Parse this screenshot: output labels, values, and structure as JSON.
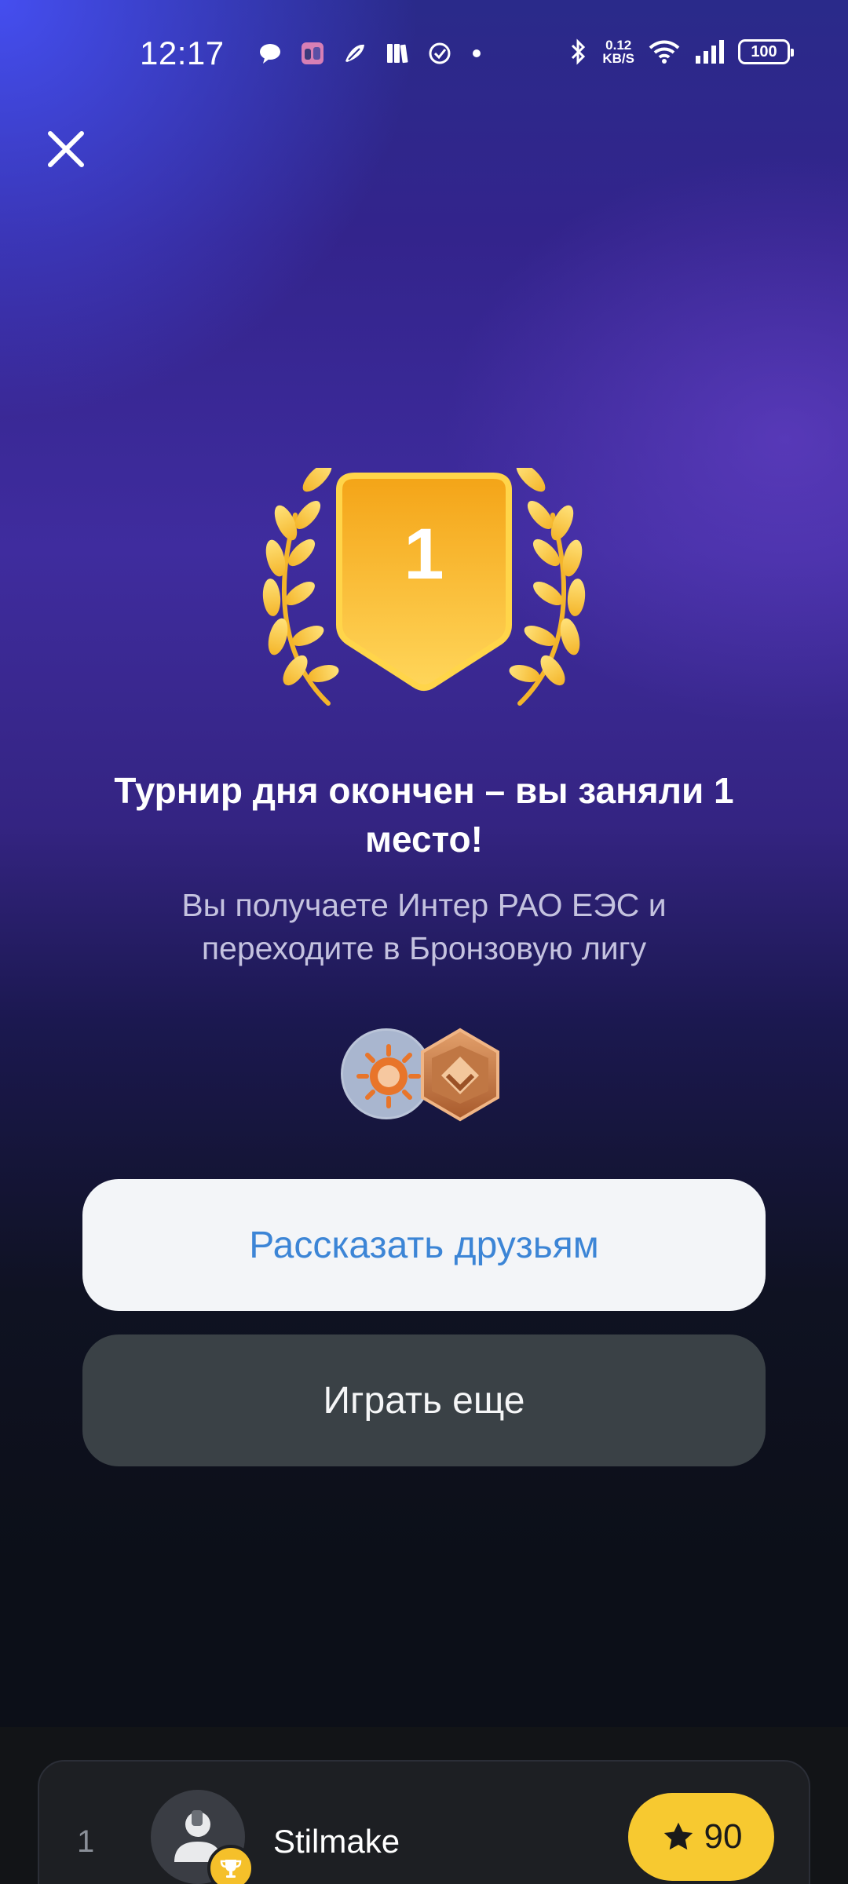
{
  "status_bar": {
    "time": "12:17",
    "net_speed_value": "0.12",
    "net_speed_unit": "KB/S",
    "battery": "100",
    "left_icons": [
      "chat-bubble-icon",
      "app-thumbnail-icon",
      "feather-icon",
      "library-icon",
      "check-circle-icon",
      "dot-icon"
    ],
    "right_icons": [
      "bluetooth-icon",
      "wifi-icon",
      "signal-icon",
      "battery-icon"
    ]
  },
  "result": {
    "place": "1",
    "title": "Турнир дня окончен – вы заняли 1 место!",
    "subtitle": "Вы получаете Интер РАО ЕЭС и переходите в Бронзовую лигу"
  },
  "rewards": {
    "company_icon": "inter-rao-logo-icon",
    "league_icon": "bronze-league-badge-icon"
  },
  "buttons": {
    "share_label": "Рассказать друзьям",
    "play_again_label": "Играть еще"
  },
  "leaderboard": {
    "rows": [
      {
        "rank": "1",
        "name": "Stilmake",
        "score": "90"
      }
    ]
  },
  "colors": {
    "accent_gold": "#F7C930",
    "share_text": "#3C85D6",
    "bronze": "#C47A4A"
  }
}
